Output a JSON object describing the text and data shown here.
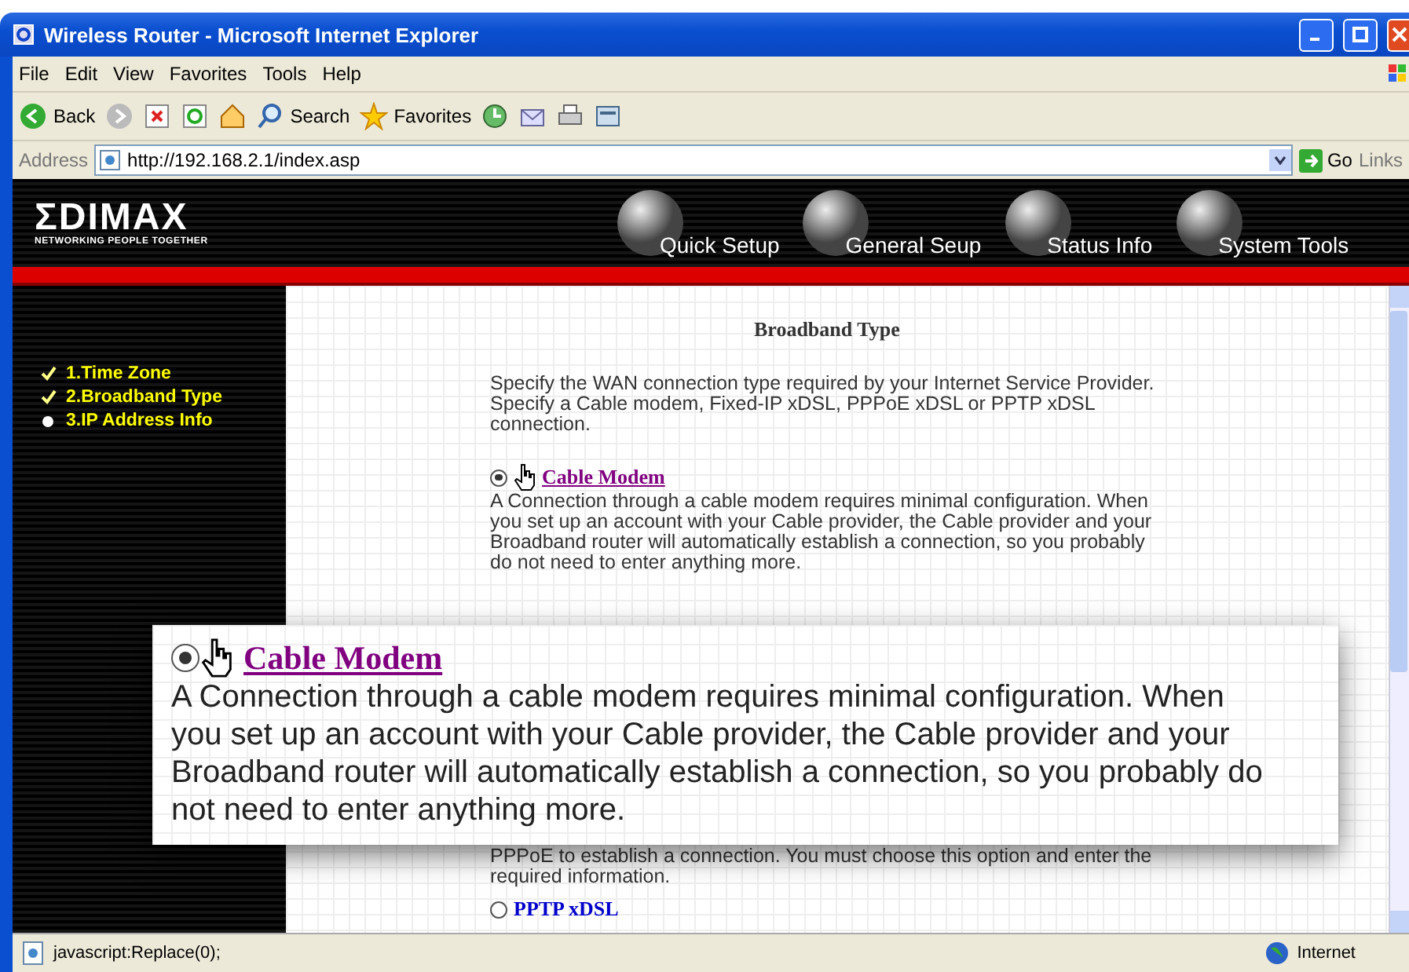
{
  "window": {
    "title": "Wireless Router - Microsoft Internet Explorer"
  },
  "menu": [
    "File",
    "Edit",
    "View",
    "Favorites",
    "Tools",
    "Help"
  ],
  "toolbar": {
    "back": "Back",
    "search": "Search",
    "favorites": "Favorites"
  },
  "address_bar": {
    "label": "Address",
    "url": "http://192.168.2.1/index.asp",
    "go": "Go",
    "links": "Links"
  },
  "banner": {
    "logo": "ΣDIMAX",
    "tagline": "NETWORKING PEOPLE TOGETHER",
    "nav": [
      "Quick Setup",
      "General Seup",
      "Status Info",
      "System Tools"
    ]
  },
  "sidebar": {
    "items": [
      {
        "label": "1.Time Zone",
        "done": true
      },
      {
        "label": "2.Broadband Type",
        "done": true
      },
      {
        "label": "3.IP Address Info",
        "done": false
      }
    ]
  },
  "content": {
    "heading": "Broadband Type",
    "intro": "Specify the WAN connection type required by your Internet Service Provider. Specify a Cable modem, Fixed-IP xDSL, PPPoE xDSL or PPTP xDSL connection.",
    "options_top": [
      {
        "label": "Cable Modem",
        "selected": true,
        "description": "A Connection through a cable modem requires minimal configuration. When you set up an account with your Cable provider, the Cable provider and your Broadband router will automatically establish a connection, so you probably do not need to enter anything more."
      }
    ],
    "partial_text": "PPPoE to establish a connection. You must choose this option and enter the required information.",
    "options_bottom": [
      {
        "label": "PPTP xDSL",
        "selected": false
      }
    ]
  },
  "magnified_callout": {
    "label": "Cable Modem",
    "selected": true,
    "description": "A Connection through a cable modem requires minimal configuration. When you set up an account with your Cable provider, the Cable provider and your Broadband router will automatically establish a connection, so you probably do not need to enter anything more."
  },
  "status_bar": {
    "text": "javascript:Replace(0);",
    "zone": "Internet"
  }
}
